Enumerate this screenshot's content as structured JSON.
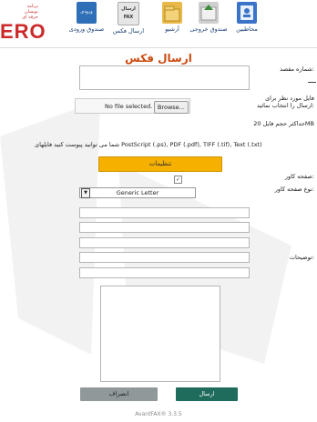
{
  "brand": {
    "small_lines": [
      "برنامه",
      "نویسان",
      "حرفه ای"
    ],
    "logo_text": "ERO"
  },
  "nav": [
    {
      "id": "contacts",
      "label": "مخاطبین",
      "icon": "contacts-icon",
      "color": "#3b73c8"
    },
    {
      "id": "outbox",
      "label": "صندوق خروجی",
      "icon": "outbox-icon",
      "color": "#cfcfcf"
    },
    {
      "id": "archive",
      "label": "آرشیو",
      "icon": "archive-icon",
      "color": "#e9b949"
    },
    {
      "id": "send_fax",
      "label": "ارسال فکس",
      "icon": "fax-icon",
      "color": "#e6e6e6",
      "icon_text": "ارسال FAX"
    },
    {
      "id": "inbox",
      "label": "صندوق ورودی",
      "icon": "inbox-icon",
      "color": "#2f6fb8",
      "icon_text": "ورودی"
    }
  ],
  "page": {
    "title": "ارسال فکس",
    "destination_label": "شماره مقصد:",
    "file_label": "فایل مورد نظر برای ارسال را انتخاب نمائید:",
    "file_browse": "Browse...",
    "file_status": "No file selected.",
    "max_size_label": "حداکثر حجم فایل 20MB",
    "formats_note": "شما می توانید پیوست کنید فایلهای PostScript (.ps), PDF (.pdf), TIFF (.tif), Text (.txt)",
    "settings_button": "تنظیمات",
    "cover_label": "صفحه کاور:",
    "cover_type_label": "نوع صفحه کاور:",
    "cover_type_value": "Generic Letter",
    "comments_label": "توضیحات:",
    "send_button": "ارسال",
    "cancel_button": "انصراف"
  },
  "footer": "AvantFAX® 3.3.5"
}
